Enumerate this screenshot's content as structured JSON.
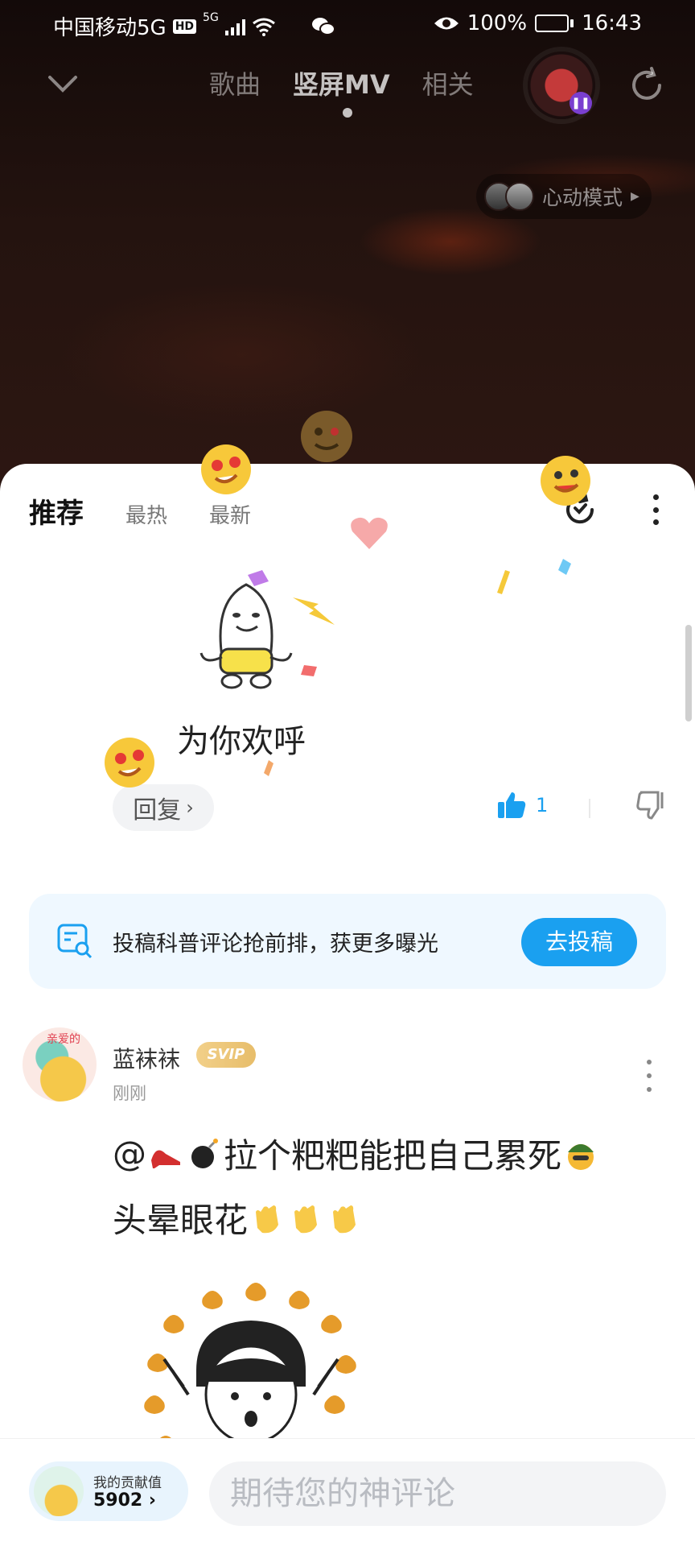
{
  "status_bar": {
    "carrier": "中国移动5G",
    "hd": "HD",
    "network": "5G",
    "battery": "100%",
    "time": "16:43"
  },
  "mv_header": {
    "tabs": [
      {
        "label": "歌曲",
        "active": false
      },
      {
        "label": "竖屏MV",
        "active": true
      },
      {
        "label": "相关",
        "active": false
      }
    ]
  },
  "heart_mode": {
    "label": "心动模式"
  },
  "sort_tabs": [
    {
      "label": "推荐",
      "active": true
    },
    {
      "label": "最热",
      "active": false
    },
    {
      "label": "最新",
      "active": false
    }
  ],
  "first_comment": {
    "sticker_caption": "为你欢呼",
    "reply_label": "回复",
    "like_count": "1"
  },
  "banner": {
    "text": "投稿科普评论抢前排，获更多曝光",
    "button": "去投稿"
  },
  "comment": {
    "username": "蓝袜袜",
    "badge": "SVIP",
    "time": "刚刚",
    "avatar_text": "亲爱的",
    "line1_prefix": "@",
    "line1_text": "拉个粑粑能把自己累死",
    "line2_text": "头晕眼花"
  },
  "bottom_bar": {
    "contrib_label": "我的贡献值",
    "contrib_value": "5902",
    "input_placeholder": "期待您的神评论"
  },
  "colors": {
    "accent": "#1aa0f0",
    "svip": "#e7bd6a",
    "dark_bg": "#1c0f0c"
  }
}
